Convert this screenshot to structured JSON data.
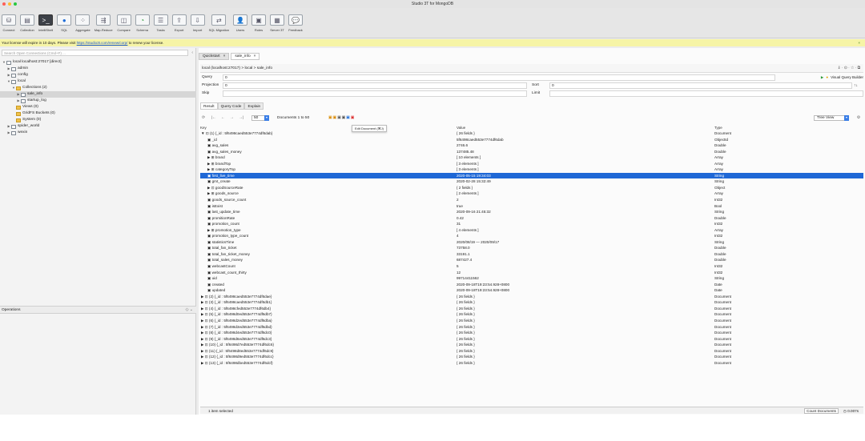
{
  "window": {
    "title": "Studio 3T for MongoDB"
  },
  "toolbar": [
    {
      "label": "Connect",
      "icon": "connect-icon",
      "glyph": "⛁"
    },
    {
      "label": "Collection",
      "icon": "collection-icon",
      "glyph": "▤"
    },
    {
      "label": "IntelliShell",
      "icon": "intellishell-icon",
      "glyph": ">_"
    },
    {
      "label": "SQL",
      "icon": "sql-icon",
      "glyph": "●"
    },
    {
      "label": "Aggregate",
      "icon": "aggregate-icon",
      "glyph": "⁘"
    },
    {
      "label": "Map-Reduce",
      "icon": "map-reduce-icon",
      "glyph": "⇶"
    },
    {
      "label": "Compare",
      "icon": "compare-icon",
      "glyph": "◫"
    },
    {
      "label": "Schema",
      "icon": "schema-icon",
      "glyph": "◔"
    },
    {
      "label": "Tasks",
      "icon": "tasks-icon",
      "glyph": "☰"
    },
    {
      "label": "Export",
      "icon": "export-icon",
      "glyph": "⇪"
    },
    {
      "label": "Import",
      "icon": "import-icon",
      "glyph": "⇩"
    },
    {
      "label": "SQL Migration",
      "icon": "sql-migration-icon",
      "glyph": "⇄"
    },
    {
      "label": "Users",
      "icon": "users-icon",
      "glyph": "👤"
    },
    {
      "label": "Roles",
      "icon": "roles-icon",
      "glyph": "▣"
    },
    {
      "label": "Server 3T",
      "icon": "server-icon",
      "glyph": "▦"
    },
    {
      "label": "Feedback",
      "icon": "feedback-icon",
      "glyph": "💬"
    }
  ],
  "license": {
    "text_before": "Your license will expire in 10 days. Please visit ",
    "link": "https://studio3t.com/renew/corp/",
    "text_after": " to renew your license.",
    "close": "×"
  },
  "connections": {
    "search_placeholder": "Search Open Connections (Cmd+F) ...",
    "tree": [
      {
        "label": "local localhost:27017 [direct]",
        "depth": 0,
        "arrow": "▼",
        "icon": "server"
      },
      {
        "label": "admin",
        "depth": 1,
        "arrow": "▶",
        "icon": "db"
      },
      {
        "label": "config",
        "depth": 1,
        "arrow": "▶",
        "icon": "db"
      },
      {
        "label": "local",
        "depth": 1,
        "arrow": "▼",
        "icon": "db"
      },
      {
        "label": "Collections (2)",
        "depth": 2,
        "arrow": "▼",
        "icon": "folder"
      },
      {
        "label": "sale_info",
        "depth": 3,
        "arrow": "▶",
        "icon": "coll",
        "selected": true
      },
      {
        "label": "startup_log",
        "depth": 3,
        "arrow": "▶",
        "icon": "coll"
      },
      {
        "label": "Views (0)",
        "depth": 2,
        "arrow": "",
        "icon": "folder"
      },
      {
        "label": "GridFS Buckets (0)",
        "depth": 2,
        "arrow": "",
        "icon": "folder"
      },
      {
        "label": "System (0)",
        "depth": 2,
        "arrow": "",
        "icon": "folder"
      },
      {
        "label": "spider_world",
        "depth": 1,
        "arrow": "▶",
        "icon": "db"
      },
      {
        "label": "wexin",
        "depth": 1,
        "arrow": "▶",
        "icon": "db"
      }
    ],
    "operations_label": "Operations"
  },
  "tabs": [
    {
      "label": "Quickstart",
      "close": "×"
    },
    {
      "label": "sale_info",
      "close": "×",
      "active": true
    }
  ],
  "path": "local (localhost:27017)  >  local  >  sale_info",
  "query": {
    "query_label": "Query",
    "query_value": "0",
    "projection_label": "Projection",
    "projection_value": "0",
    "sort_label": "Sort",
    "sort_value": "0",
    "skip_label": "Skip",
    "limit_label": "Limit",
    "visual_builder": "Visual Query Builder"
  },
  "subtabs": [
    "Result",
    "Query Code",
    "Explain"
  ],
  "nav": {
    "page_size": "50",
    "range": "Documents 1 to 50",
    "view_mode": "Tree View",
    "tooltip": "Edit Document (⌘J)"
  },
  "columns": [
    "Key",
    "Value",
    "Type"
  ],
  "rows": [
    {
      "key": "▼ ⊡ (1) {_id : 5f6498caed553e7774df6dab}",
      "value": "{ 26 fields }",
      "type": "Document",
      "depth": 0
    },
    {
      "key": "▣ _id",
      "value": "5f6498caed553e7774df6dab",
      "type": "ObjectId",
      "depth": 1
    },
    {
      "key": "▣ avg_sales",
      "value": "2746.6",
      "type": "Double",
      "depth": 1
    },
    {
      "key": "▣ avg_sales_money",
      "value": "137485.48",
      "type": "Double",
      "depth": 1
    },
    {
      "key": "▶ ⊞ brand",
      "value": "[ 10 elements ]",
      "type": "Array",
      "depth": 1
    },
    {
      "key": "▶ ⊞ brandTop",
      "value": "[ 3 elements ]",
      "type": "Array",
      "depth": 1
    },
    {
      "key": "▶ ⊞ categoryTop",
      "value": "[ 3 elements ]",
      "type": "Array",
      "depth": 1
    },
    {
      "key": "▣ first_live_time",
      "value": "2020-05-15 19:34:03",
      "type": "String",
      "depth": 1,
      "selected": true
    },
    {
      "key": "▣ gmt_create",
      "value": "2020-02-28 15:32:49",
      "type": "String",
      "depth": 1
    },
    {
      "key": "▶ ⊡ goodSourceRate",
      "value": "{ 2 fields }",
      "type": "Object",
      "depth": 1
    },
    {
      "key": "▶ ⊞ goods_source",
      "value": "[ 2 elements ]",
      "type": "Array",
      "depth": 1
    },
    {
      "key": "▣ goods_source_count",
      "value": "2",
      "type": "Int32",
      "depth": 1
    },
    {
      "key": "▣ isExist",
      "value": "true",
      "type": "Bool",
      "depth": 1
    },
    {
      "key": "▣ last_update_time",
      "value": "2020-09-16 21:45:32",
      "type": "String",
      "depth": 1
    },
    {
      "key": "▣ promitionRate",
      "value": "0.42",
      "type": "Double",
      "depth": 1
    },
    {
      "key": "▣ promotion_count",
      "value": "31",
      "type": "Int32",
      "depth": 1
    },
    {
      "key": "▶ ⊞ promotion_type",
      "value": "[ 4 elements ]",
      "type": "Array",
      "depth": 1
    },
    {
      "key": "▣ promotion_type_count",
      "value": "4",
      "type": "Int32",
      "depth": 1
    },
    {
      "key": "▣ statisticsTime",
      "value": "2020/08/19 — 2020/09/17",
      "type": "String",
      "depth": 1
    },
    {
      "key": "▣ total_fan_ticket",
      "value": "73758.0",
      "type": "Double",
      "depth": 1
    },
    {
      "key": "▣ total_fan_ticket_money",
      "value": "33191.1",
      "type": "Double",
      "depth": 1
    },
    {
      "key": "▣ total_sales_money",
      "value": "687427.4",
      "type": "Double",
      "depth": 1
    },
    {
      "key": "▣ webcastCount",
      "value": "5",
      "type": "Int32",
      "depth": 1
    },
    {
      "key": "▣ webcast_count_thirty",
      "value": "12",
      "type": "Int32",
      "depth": 1
    },
    {
      "key": "▣ uid",
      "value": "99714411562",
      "type": "String",
      "depth": 1
    },
    {
      "key": "▣ created",
      "value": "2020-09-18T19:23:54.928+0800",
      "type": "Date",
      "depth": 1
    },
    {
      "key": "▣ updated",
      "value": "2020-09-18T19:23:54.928+0800",
      "type": "Date",
      "depth": 1
    },
    {
      "key": "▶ ⊡ (2) {_id : 5f6498caed553e7774df6dae}",
      "value": "{ 26 fields }",
      "type": "Document",
      "depth": 0
    },
    {
      "key": "▶ ⊡ (3) {_id : 5f6498caed553e7774df6db1}",
      "value": "{ 26 fields }",
      "type": "Document",
      "depth": 0
    },
    {
      "key": "▶ ⊡ (4) {_id : 5f6498cfed553e7774df6db4}",
      "value": "{ 26 fields }",
      "type": "Document",
      "depth": 0
    },
    {
      "key": "▶ ⊡ (5) {_id : 5f6498d0ed553e7774df6db7}",
      "value": "{ 26 fields }",
      "type": "Document",
      "depth": 0
    },
    {
      "key": "▶ ⊡ (6) {_id : 5f6498d2ed553e7774df6dba}",
      "value": "{ 26 fields }",
      "type": "Document",
      "depth": 0
    },
    {
      "key": "▶ ⊡ (7) {_id : 5f6498d3ed553e7774df6dbd}",
      "value": "{ 26 fields }",
      "type": "Document",
      "depth": 0
    },
    {
      "key": "▶ ⊡ (8) {_id : 5f6498d4ed553e7774df6dc0}",
      "value": "{ 26 fields }",
      "type": "Document",
      "depth": 0
    },
    {
      "key": "▶ ⊡ (9) {_id : 5f6498d6ed553e7774df6dc3}",
      "value": "{ 26 fields }",
      "type": "Document",
      "depth": 0
    },
    {
      "key": "▶ ⊡ (10) {_id : 5f6498d7ed553e7774df6dc6}",
      "value": "{ 26 fields }",
      "type": "Document",
      "depth": 0
    },
    {
      "key": "▶ ⊡ (11) {_id : 5f6498d8ed553e7774df6dc9}",
      "value": "{ 26 fields }",
      "type": "Document",
      "depth": 0
    },
    {
      "key": "▶ ⊡ (12) {_id : 5f6498d9ed553e7774df6dcc}",
      "value": "{ 26 fields }",
      "type": "Document",
      "depth": 0
    },
    {
      "key": "▶ ⊡ (13) {_id : 5f6498dbed553e7774df6dcf}",
      "value": "{ 26 fields }",
      "type": "Document",
      "depth": 0
    }
  ],
  "status": {
    "left": "1 item selected",
    "count_docs": "Count Documents",
    "time": "0.007s"
  },
  "colors": {
    "selection": "#1f68d6",
    "license_bg": "#f6f4a6",
    "link": "#1a55d6"
  }
}
